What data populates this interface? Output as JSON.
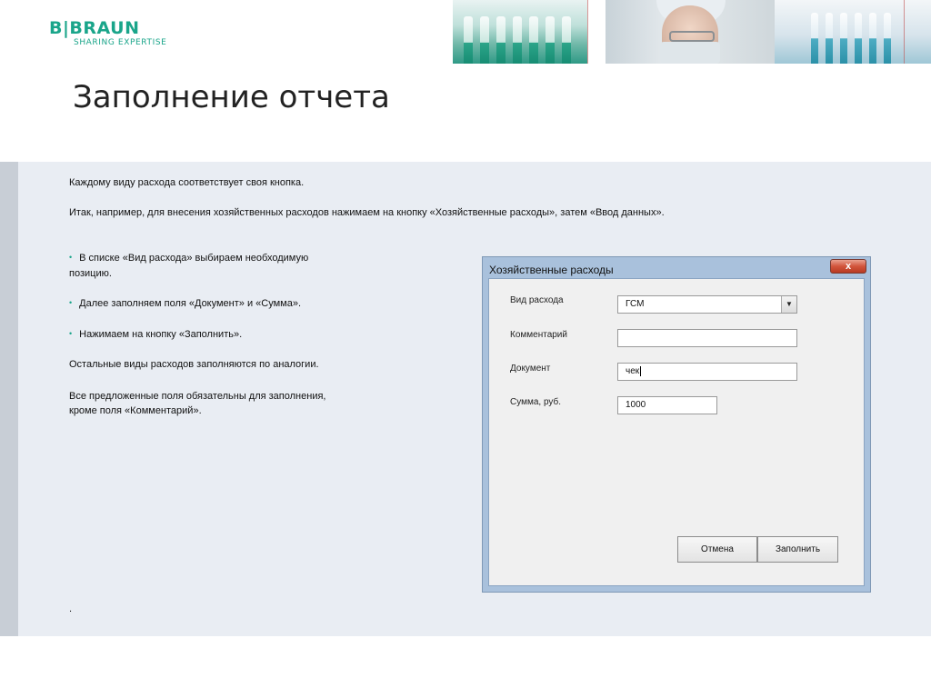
{
  "header": {
    "logo_text": "B|BRAUN",
    "logo_tagline": "SHARING EXPERTISE",
    "slide_title": "Заполнение отчета"
  },
  "body_text": {
    "p1": "Каждому виду расхода соответствует своя кнопка.",
    "p2": "Итак, например, для внесения хозяйственных расходов нажимаем на кнопку «Хозяйственные расходы», затем «Ввод данных».",
    "bullets": [
      {
        "marker": "•",
        "line1": "В списке «Вид расхода» выбираем необходимую",
        "line2": "позицию."
      },
      {
        "marker": "•",
        "line1": "Далее заполняем поля «Документ» и «Сумма»."
      },
      {
        "marker": "•",
        "line1": "Нажимаем на кнопку «Заполнить»."
      }
    ],
    "p3": "Остальные виды расходов заполняются по аналогии.",
    "p4_line1": "Все предложенные поля обязательны для заполнения,",
    "p4_line2": "кроме поля «Комментарий».",
    "footnote": "."
  },
  "dialog": {
    "title": "Хозяйственные расходы",
    "close_label": "x",
    "fields": {
      "expense_type": {
        "label": "Вид расхода",
        "value": "ГСМ",
        "arrow": "▼"
      },
      "comment": {
        "label": "Комментарий",
        "value": ""
      },
      "document": {
        "label": "Документ",
        "value": "чек"
      },
      "amount": {
        "label": "Сумма, руб.",
        "value": "1000"
      }
    },
    "buttons": {
      "cancel": "Отмена",
      "fill": "Заполнить"
    }
  },
  "colors": {
    "brand": "#1aa58a",
    "content_bg": "#e9edf3",
    "dialog_frame": "#a9c1dc",
    "close_red": "#d2553c"
  }
}
